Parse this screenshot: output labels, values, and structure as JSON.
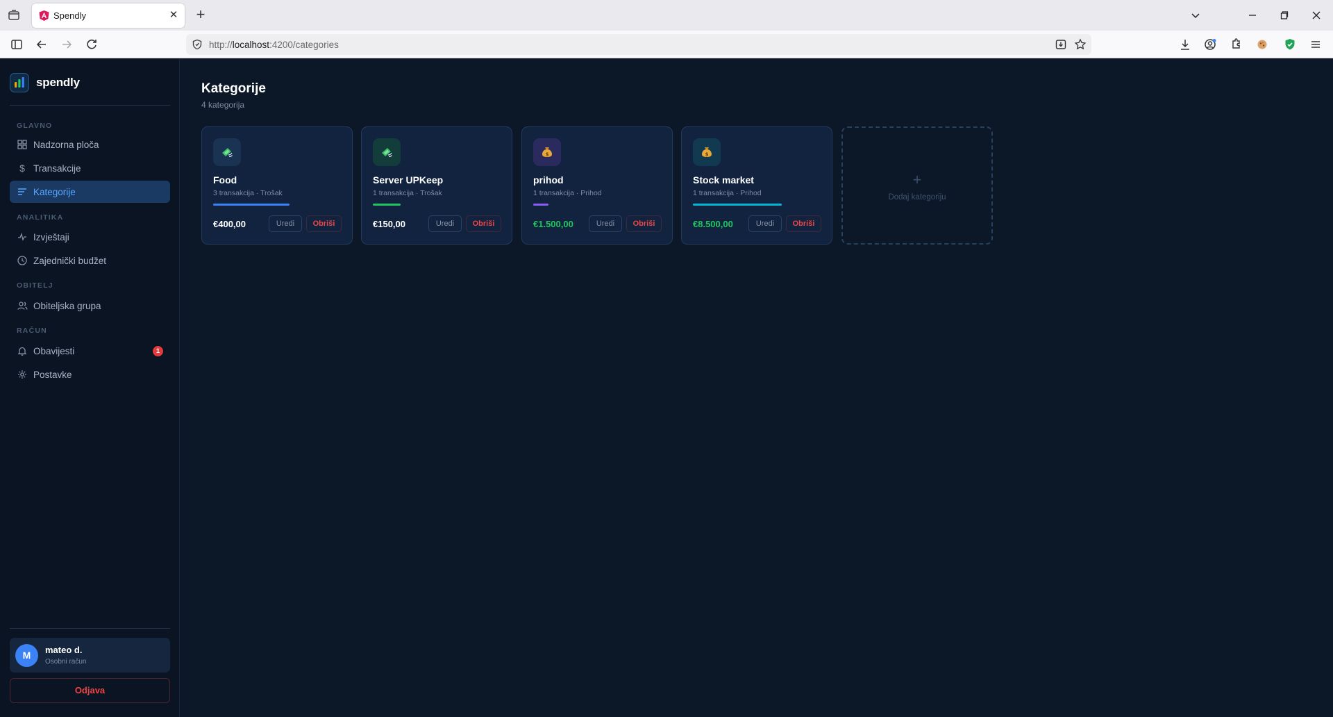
{
  "browser": {
    "tab_title": "Spendly",
    "url_prefix": "http://",
    "url_host": "localhost",
    "url_path": ":4200/categories"
  },
  "app": {
    "brand": "spendly",
    "nav_sections": [
      {
        "label": "GLAVNO"
      },
      {
        "label": "ANALITIKA"
      },
      {
        "label": "OBITELJ"
      },
      {
        "label": "RAČUN"
      }
    ],
    "nav": {
      "dashboard": "Nadzorna ploča",
      "transactions": "Transakcije",
      "categories": "Kategorije",
      "reports": "Izvještaji",
      "shared_budget": "Zajednički budžet",
      "family_group": "Obiteljska grupa",
      "notifications": "Obavijesti",
      "notifications_badge": "1",
      "settings": "Postavke"
    },
    "user": {
      "initial": "M",
      "name": "mateo d.",
      "account_type": "Osobni račun"
    },
    "logout_label": "Odjava"
  },
  "page": {
    "title": "Kategorije",
    "subtitle": "4 kategorija"
  },
  "categories": [
    {
      "name": "Food",
      "meta": "3 transakcija · Trošak",
      "amount": "€400,00",
      "type": "expense",
      "icon": "money-wings-icon",
      "bar_fill": 0.55,
      "bar_color": "#3b82f6",
      "icon_bg": "#1b3352"
    },
    {
      "name": "Server UPKeep",
      "meta": "1 transakcija · Trošak",
      "amount": "€150,00",
      "type": "expense",
      "icon": "money-wings-icon",
      "bar_fill": 0.2,
      "bar_color": "#22c55e",
      "icon_bg": "#123d3b"
    },
    {
      "name": "prihod",
      "meta": "1 transakcija · Prihod",
      "amount": "€1.500,00",
      "type": "income",
      "icon": "money-bag-icon",
      "bar_fill": 0.11,
      "bar_color": "#8b5cf6",
      "icon_bg": "#2b2a5e"
    },
    {
      "name": "Stock market",
      "meta": "1 transakcija · Prihod",
      "amount": "€8.500,00",
      "type": "income",
      "icon": "money-bag-icon",
      "bar_fill": 0.64,
      "bar_color": "#06b6d4",
      "icon_bg": "#11394f"
    }
  ],
  "buttons": {
    "edit": "Uredi",
    "delete": "Obriši"
  },
  "add_card": {
    "plus": "+",
    "label": "Dodaj kategoriju"
  }
}
